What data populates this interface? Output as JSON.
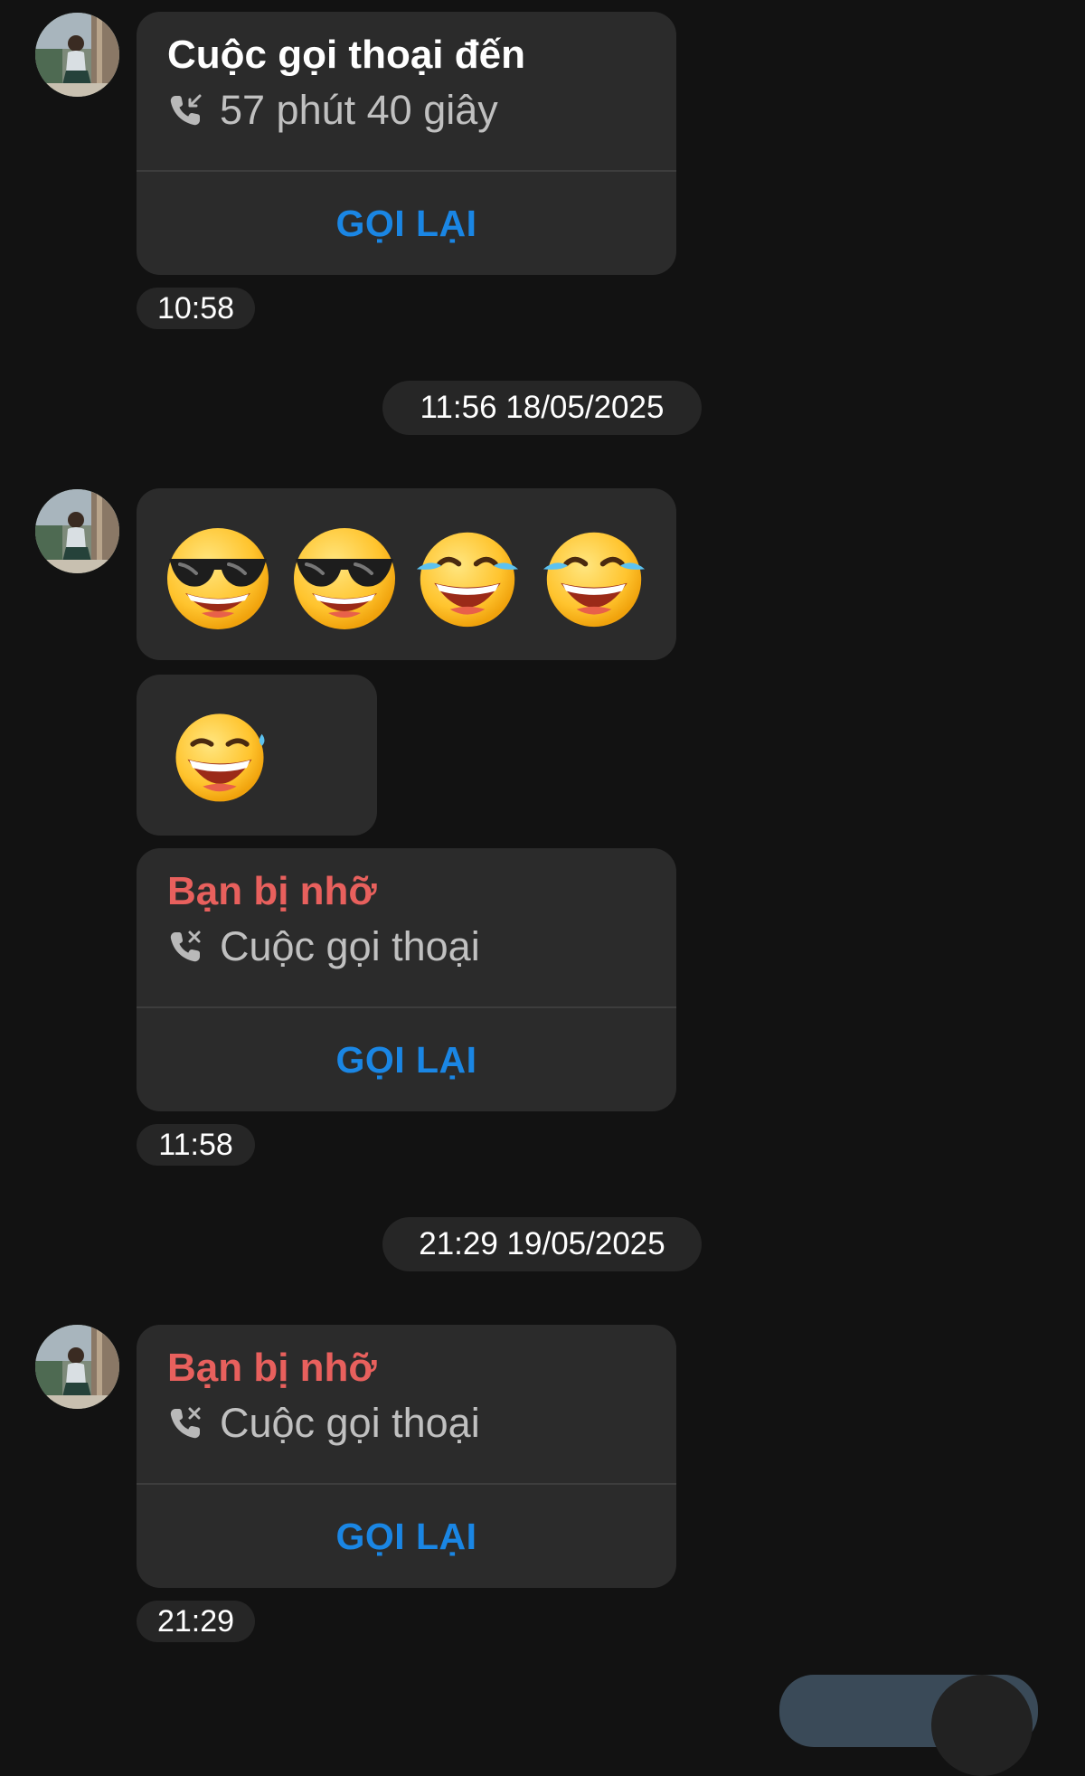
{
  "messages": {
    "call1": {
      "title": "Cuộc gọi thoại đến",
      "detail": "57 phút 40 giây",
      "action": "GỌI LẠI",
      "time": "10:58"
    },
    "date1": "11:56 18/05/2025",
    "emoji_row1": [
      "cool-face-emoji",
      "cool-face-emoji",
      "tears-of-joy-emoji",
      "tears-of-joy-emoji"
    ],
    "emoji_row2": [
      "laughing-sweat-emoji"
    ],
    "call2": {
      "title": "Bạn bị nhỡ",
      "detail": "Cuộc gọi thoại",
      "action": "GỌI LẠI",
      "time": "11:58"
    },
    "date2": "21:29 19/05/2025",
    "call3": {
      "title": "Bạn bị nhỡ",
      "detail": "Cuộc gọi thoại",
      "action": "GỌI LẠI",
      "time": "21:29"
    }
  },
  "colors": {
    "background": "#121212",
    "bubble": "#2b2b2b",
    "missed": "#e8605d",
    "action": "#1a86e4"
  }
}
